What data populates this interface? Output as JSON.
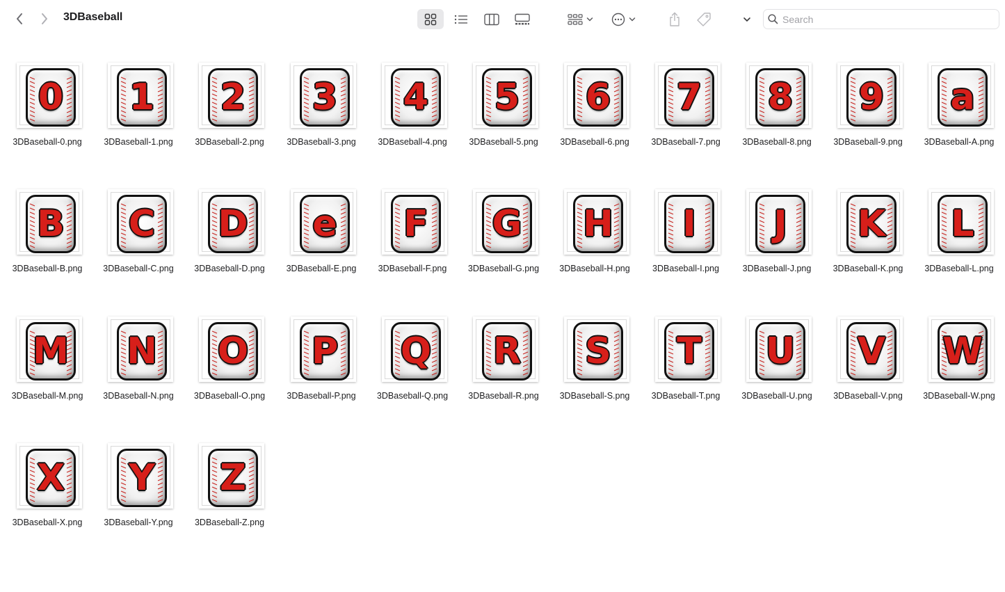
{
  "window": {
    "title": "3DBaseball",
    "search_placeholder": "Search"
  },
  "toolbar_icons": [
    "back-icon",
    "forward-icon",
    "icon-view-icon",
    "list-view-icon",
    "column-view-icon",
    "gallery-view-icon",
    "group-by-icon",
    "more-actions-icon",
    "share-icon",
    "tag-icon",
    "expand-chevron-icon",
    "search-icon"
  ],
  "colors": {
    "accent_red": "#d71f1a",
    "outline": "#111111",
    "selected_view_bg": "#e8e8ea"
  },
  "files": [
    {
      "glyph": "0",
      "name": "3DBaseball-0.png"
    },
    {
      "glyph": "1",
      "name": "3DBaseball-1.png"
    },
    {
      "glyph": "2",
      "name": "3DBaseball-2.png"
    },
    {
      "glyph": "3",
      "name": "3DBaseball-3.png"
    },
    {
      "glyph": "4",
      "name": "3DBaseball-4.png"
    },
    {
      "glyph": "5",
      "name": "3DBaseball-5.png"
    },
    {
      "glyph": "6",
      "name": "3DBaseball-6.png"
    },
    {
      "glyph": "7",
      "name": "3DBaseball-7.png"
    },
    {
      "glyph": "8",
      "name": "3DBaseball-8.png"
    },
    {
      "glyph": "9",
      "name": "3DBaseball-9.png"
    },
    {
      "glyph": "a",
      "name": "3DBaseball-A.png"
    },
    {
      "glyph": "B",
      "name": "3DBaseball-B.png"
    },
    {
      "glyph": "C",
      "name": "3DBaseball-C.png"
    },
    {
      "glyph": "D",
      "name": "3DBaseball-D.png"
    },
    {
      "glyph": "e",
      "name": "3DBaseball-E.png"
    },
    {
      "glyph": "F",
      "name": "3DBaseball-F.png"
    },
    {
      "glyph": "G",
      "name": "3DBaseball-G.png"
    },
    {
      "glyph": "H",
      "name": "3DBaseball-H.png"
    },
    {
      "glyph": "I",
      "name": "3DBaseball-I.png"
    },
    {
      "glyph": "J",
      "name": "3DBaseball-J.png"
    },
    {
      "glyph": "K",
      "name": "3DBaseball-K.png"
    },
    {
      "glyph": "L",
      "name": "3DBaseball-L.png"
    },
    {
      "glyph": "M",
      "name": "3DBaseball-M.png"
    },
    {
      "glyph": "N",
      "name": "3DBaseball-N.png"
    },
    {
      "glyph": "O",
      "name": "3DBaseball-O.png"
    },
    {
      "glyph": "P",
      "name": "3DBaseball-P.png"
    },
    {
      "glyph": "Q",
      "name": "3DBaseball-Q.png"
    },
    {
      "glyph": "R",
      "name": "3DBaseball-R.png"
    },
    {
      "glyph": "S",
      "name": "3DBaseball-S.png"
    },
    {
      "glyph": "T",
      "name": "3DBaseball-T.png"
    },
    {
      "glyph": "U",
      "name": "3DBaseball-U.png"
    },
    {
      "glyph": "V",
      "name": "3DBaseball-V.png"
    },
    {
      "glyph": "W",
      "name": "3DBaseball-W.png"
    },
    {
      "glyph": "X",
      "name": "3DBaseball-X.png"
    },
    {
      "glyph": "Y",
      "name": "3DBaseball-Y.png"
    },
    {
      "glyph": "Z",
      "name": "3DBaseball-Z.png"
    }
  ]
}
